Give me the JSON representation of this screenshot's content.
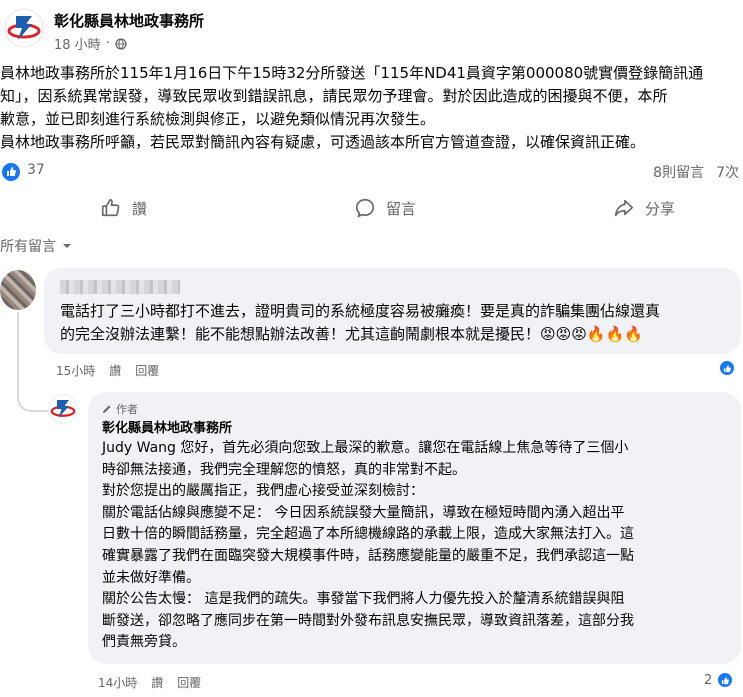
{
  "post": {
    "page_name": "彰化縣員林地政事務所",
    "time": "18 小時",
    "dot": "·",
    "body_lines": [
      "員林地政事務所於115年1月16日下午15時32分所發送「115年ND41員資字第000080號實價登錄簡訊通",
      "知」，因系統異常誤發，導致民眾收到錯誤訊息，請民眾勿予理會。對於因此造成的困擾與不便，本所",
      "歉意，並已即刻進行系統檢測與修正，以避免類似情況再次發生。",
      "員林地政事務所呼籲，若民眾對簡訊內容有疑慮，可透過該本所官方管道查證，以確保資訊正確。"
    ]
  },
  "stats": {
    "likes": "37",
    "comments": "8則留言",
    "shares": "7次"
  },
  "actions": {
    "like": "讚",
    "comment": "留言",
    "share": "分享"
  },
  "filter": {
    "label": "所有留言"
  },
  "comment1": {
    "lines": [
      "電話打了三小時都打不進去，證明貴司的系統極度容易被癱瘓！要是真的詐騙集團佔線還真",
      "的完全沒辦法連繫！能不能想點辦法改善！尤其這齣鬧劇根本就是擾民！😡😡😡🔥🔥🔥"
    ],
    "time": "15小時",
    "like_label": "讚",
    "reply_label": "回覆"
  },
  "reply": {
    "author_tag": "作者",
    "name": "彰化縣員林地政事務所",
    "lines": [
      "Judy Wang 您好，首先必須向您致上最深的歉意。讓您在電話線上焦急等待了三個小",
      "時卻無法接通，我們完全理解您的憤怒，真的非常對不起。",
      "對於您提出的嚴厲指正，我們虛心接受並深刻檢討：",
      "關於電話佔線與應變不足： 今日因系統誤發大量簡訊，導致在極短時間內湧入超出平",
      "日數十倍的瞬間話務量，完全超過了本所總機線路的承載上限，造成大家無法打入。這",
      "確實暴露了我們在面臨突發大規模事件時，話務應變能量的嚴重不足，我們承認這一點",
      "並未做好準備。",
      "關於公告太慢： 這是我們的疏失。事發當下我們將人力優先投入於釐清系統錯誤與阻",
      "斷發送，卻忽略了應同步在第一時間對外發布訊息安撫民眾，導致資訊落差，這部分我",
      "們責無旁貸。"
    ],
    "time": "14小時",
    "like_label": "讚",
    "reply_label": "回覆",
    "like_count": "2"
  },
  "colors": {
    "facebook_blue": "#1877f2",
    "secondary_text": "#65676b",
    "bubble_bg": "#f0f2f5",
    "logo_red": "#d7262b",
    "logo_blue": "#1b5fb0"
  },
  "icons": {
    "globe": "globe-icon",
    "like": "thumbs-up-icon",
    "comment": "speech-bubble-icon",
    "share": "share-arrow-icon",
    "caret": "caret-down-icon",
    "pencil": "pencil-icon"
  }
}
